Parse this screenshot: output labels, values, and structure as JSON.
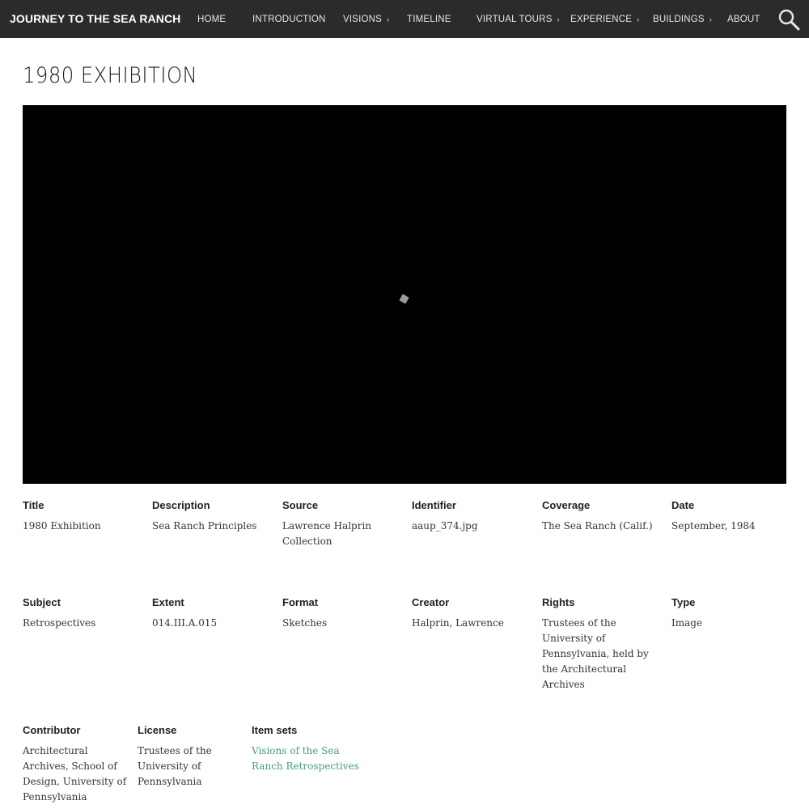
{
  "site": {
    "title": "JOURNEY TO THE SEA RANCH"
  },
  "nav": {
    "items": [
      {
        "label": "HOME",
        "has_submenu": false
      },
      {
        "label": "INTRODUCTION",
        "has_submenu": false
      },
      {
        "label": "VISIONS",
        "has_submenu": true
      },
      {
        "label": "TIMELINE",
        "has_submenu": false
      },
      {
        "label": "VIRTUAL TOURS",
        "has_submenu": true
      },
      {
        "label": "EXPERIENCE",
        "has_submenu": true
      },
      {
        "label": "BUILDINGS",
        "has_submenu": true
      },
      {
        "label": "ABOUT",
        "has_submenu": false
      }
    ],
    "submenu_glyph": "›",
    "search_icon": "search-icon"
  },
  "page": {
    "title": "1980 EXHIBITION"
  },
  "metadata": [
    {
      "label": "Title",
      "value": "1980 Exhibition"
    },
    {
      "label": "Description",
      "value": "Sea Ranch Principles"
    },
    {
      "label": "Source",
      "value": "Lawrence Halprin Collection"
    },
    {
      "label": "Identifier",
      "value": "aaup_374.jpg"
    },
    {
      "label": "Coverage",
      "value": "The Sea Ranch (Calif.)"
    },
    {
      "label": "Date",
      "value": "September, 1984"
    },
    {
      "label": "Subject",
      "value": "Retrospectives"
    },
    {
      "label": "Extent",
      "value": "014.III.A.015"
    },
    {
      "label": "Format",
      "value": "Sketches"
    },
    {
      "label": "Creator",
      "value": "Halprin, Lawrence"
    },
    {
      "label": "Rights",
      "value": "Trustees of the University of Pennsylvania, held by the Architectural Archives"
    },
    {
      "label": "Type",
      "value": "Image"
    },
    {
      "label": "Contributor",
      "value": "Architectural Archives, School of Design, University of Pennsylvania"
    },
    {
      "label": "License",
      "value": "Trustees of the University of Pennsylvania"
    },
    {
      "label": "Item sets",
      "value": "Visions of the Sea Ranch Retrospectives",
      "link": true
    }
  ],
  "colors": {
    "nav_bg": "#2b2b2b",
    "link": "#4a9a86",
    "viewer_bg": "#000000"
  }
}
